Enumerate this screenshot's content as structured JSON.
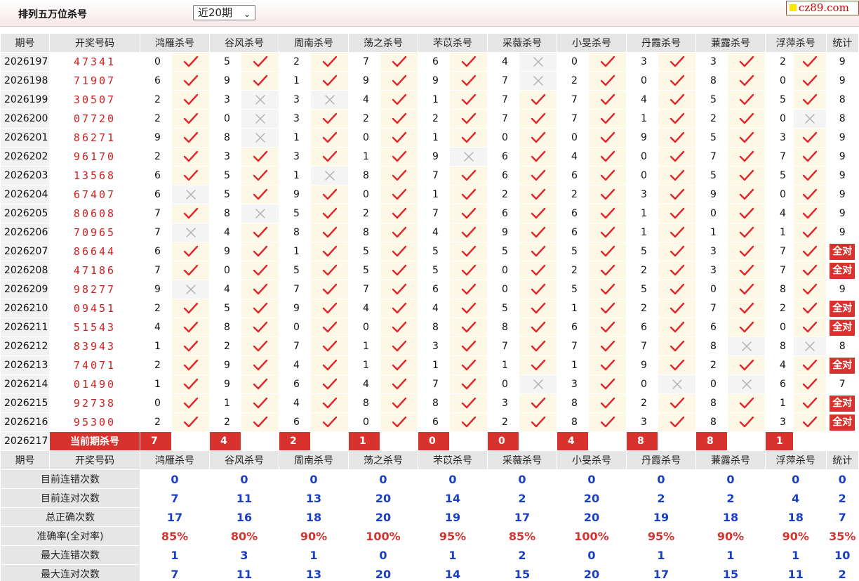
{
  "page": {
    "title": "排列五万位杀号",
    "period_select": "近20期",
    "brand": "cz89.com"
  },
  "columns": {
    "issue": "期号",
    "draw": "开奖号码",
    "experts": [
      "鸿雁杀号",
      "谷风杀号",
      "周南杀号",
      "荡之杀号",
      "芣苡杀号",
      "采薇杀号",
      "小旻杀号",
      "丹霞杀号",
      "蒹露杀号",
      "浮萍杀号"
    ],
    "stat": "统计"
  },
  "rows": [
    {
      "issue": "2026197",
      "draw": "47341",
      "picks": [
        "0",
        "5",
        "2",
        "7",
        "6",
        "4",
        "0",
        "3",
        "3",
        "2"
      ],
      "ok": [
        1,
        1,
        1,
        1,
        1,
        0,
        1,
        1,
        1,
        1
      ],
      "stat": "9"
    },
    {
      "issue": "2026198",
      "draw": "71907",
      "picks": [
        "6",
        "9",
        "1",
        "9",
        "9",
        "7",
        "2",
        "0",
        "8",
        "0"
      ],
      "ok": [
        1,
        1,
        1,
        1,
        1,
        0,
        1,
        1,
        1,
        1
      ],
      "stat": "9"
    },
    {
      "issue": "2026199",
      "draw": "30507",
      "picks": [
        "2",
        "3",
        "3",
        "4",
        "1",
        "7",
        "7",
        "4",
        "5",
        "5"
      ],
      "ok": [
        1,
        0,
        0,
        1,
        1,
        1,
        1,
        1,
        1,
        1
      ],
      "stat": "8"
    },
    {
      "issue": "2026200",
      "draw": "07720",
      "picks": [
        "2",
        "0",
        "3",
        "2",
        "2",
        "7",
        "7",
        "1",
        "2",
        "0"
      ],
      "ok": [
        1,
        0,
        1,
        1,
        1,
        1,
        1,
        1,
        1,
        0
      ],
      "stat": "8"
    },
    {
      "issue": "2026201",
      "draw": "86271",
      "picks": [
        "9",
        "8",
        "1",
        "0",
        "1",
        "0",
        "0",
        "9",
        "5",
        "3"
      ],
      "ok": [
        1,
        0,
        1,
        1,
        1,
        1,
        1,
        1,
        1,
        1
      ],
      "stat": "9"
    },
    {
      "issue": "2026202",
      "draw": "96170",
      "picks": [
        "2",
        "3",
        "3",
        "1",
        "9",
        "6",
        "4",
        "0",
        "7",
        "7"
      ],
      "ok": [
        1,
        1,
        1,
        1,
        0,
        1,
        1,
        1,
        1,
        1
      ],
      "stat": "9"
    },
    {
      "issue": "2026203",
      "draw": "13568",
      "picks": [
        "6",
        "5",
        "1",
        "8",
        "7",
        "6",
        "6",
        "0",
        "5",
        "5"
      ],
      "ok": [
        1,
        1,
        0,
        1,
        1,
        1,
        1,
        1,
        1,
        1
      ],
      "stat": "9"
    },
    {
      "issue": "2026204",
      "draw": "67407",
      "picks": [
        "6",
        "5",
        "9",
        "0",
        "1",
        "2",
        "2",
        "3",
        "9",
        "0"
      ],
      "ok": [
        0,
        1,
        1,
        1,
        1,
        1,
        1,
        1,
        1,
        1
      ],
      "stat": "9"
    },
    {
      "issue": "2026205",
      "draw": "80608",
      "picks": [
        "7",
        "8",
        "5",
        "2",
        "7",
        "6",
        "6",
        "1",
        "0",
        "4"
      ],
      "ok": [
        1,
        0,
        1,
        1,
        1,
        1,
        1,
        1,
        1,
        1
      ],
      "stat": "9"
    },
    {
      "issue": "2026206",
      "draw": "70965",
      "picks": [
        "7",
        "4",
        "8",
        "8",
        "4",
        "9",
        "6",
        "1",
        "1",
        "1"
      ],
      "ok": [
        0,
        1,
        1,
        1,
        1,
        1,
        1,
        1,
        1,
        1
      ],
      "stat": "9"
    },
    {
      "issue": "2026207",
      "draw": "86644",
      "picks": [
        "6",
        "9",
        "1",
        "5",
        "5",
        "5",
        "5",
        "5",
        "3",
        "7"
      ],
      "ok": [
        1,
        1,
        1,
        1,
        1,
        1,
        1,
        1,
        1,
        1
      ],
      "stat": "全对"
    },
    {
      "issue": "2026208",
      "draw": "47186",
      "picks": [
        "7",
        "0",
        "5",
        "5",
        "5",
        "0",
        "2",
        "2",
        "3",
        "7"
      ],
      "ok": [
        1,
        1,
        1,
        1,
        1,
        1,
        1,
        1,
        1,
        1
      ],
      "stat": "全对"
    },
    {
      "issue": "2026209",
      "draw": "98277",
      "picks": [
        "9",
        "4",
        "7",
        "7",
        "6",
        "0",
        "5",
        "5",
        "0",
        "8"
      ],
      "ok": [
        0,
        1,
        1,
        1,
        1,
        1,
        1,
        1,
        1,
        1
      ],
      "stat": "9"
    },
    {
      "issue": "2026210",
      "draw": "09451",
      "picks": [
        "2",
        "5",
        "9",
        "4",
        "4",
        "5",
        "1",
        "2",
        "7",
        "2"
      ],
      "ok": [
        1,
        1,
        1,
        1,
        1,
        1,
        1,
        1,
        1,
        1
      ],
      "stat": "全对"
    },
    {
      "issue": "2026211",
      "draw": "51543",
      "picks": [
        "4",
        "8",
        "0",
        "0",
        "8",
        "8",
        "6",
        "6",
        "6",
        "0"
      ],
      "ok": [
        1,
        1,
        1,
        1,
        1,
        1,
        1,
        1,
        1,
        1
      ],
      "stat": "全对"
    },
    {
      "issue": "2026212",
      "draw": "83943",
      "picks": [
        "1",
        "2",
        "7",
        "1",
        "3",
        "7",
        "7",
        "7",
        "8",
        "8"
      ],
      "ok": [
        1,
        1,
        1,
        1,
        1,
        1,
        1,
        1,
        0,
        0
      ],
      "stat": "8"
    },
    {
      "issue": "2026213",
      "draw": "74071",
      "picks": [
        "2",
        "9",
        "4",
        "1",
        "1",
        "1",
        "1",
        "9",
        "2",
        "4"
      ],
      "ok": [
        1,
        1,
        1,
        1,
        1,
        1,
        1,
        1,
        1,
        1
      ],
      "stat": "全对"
    },
    {
      "issue": "2026214",
      "draw": "01490",
      "picks": [
        "1",
        "9",
        "6",
        "4",
        "7",
        "0",
        "3",
        "0",
        "0",
        "6"
      ],
      "ok": [
        1,
        1,
        1,
        1,
        1,
        0,
        1,
        0,
        0,
        1
      ],
      "stat": "7"
    },
    {
      "issue": "2026215",
      "draw": "92738",
      "picks": [
        "0",
        "1",
        "4",
        "8",
        "8",
        "3",
        "8",
        "2",
        "8",
        "1"
      ],
      "ok": [
        1,
        1,
        1,
        1,
        1,
        1,
        1,
        1,
        1,
        1
      ],
      "stat": "全对"
    },
    {
      "issue": "2026216",
      "draw": "95300",
      "picks": [
        "2",
        "2",
        "6",
        "0",
        "6",
        "2",
        "8",
        "3",
        "8",
        "3"
      ],
      "ok": [
        1,
        1,
        1,
        1,
        1,
        1,
        1,
        1,
        1,
        1
      ],
      "stat": "全对"
    }
  ],
  "current": {
    "issue": "2026217",
    "label": "当前期杀号",
    "picks": [
      "7",
      "4",
      "2",
      "1",
      "0",
      "0",
      "4",
      "8",
      "8",
      "1"
    ]
  },
  "stats": [
    {
      "label": "目前连错次数",
      "values": [
        "0",
        "0",
        "0",
        "0",
        "0",
        "0",
        "0",
        "0",
        "0",
        "0"
      ],
      "total": "0",
      "red": false
    },
    {
      "label": "目前连对次数",
      "values": [
        "7",
        "11",
        "13",
        "20",
        "14",
        "2",
        "20",
        "2",
        "2",
        "4"
      ],
      "total": "2",
      "red": false
    },
    {
      "label": "总正确次数",
      "values": [
        "17",
        "16",
        "18",
        "20",
        "19",
        "17",
        "20",
        "19",
        "18",
        "18"
      ],
      "total": "7",
      "red": false
    },
    {
      "label": "准确率(全对率)",
      "values": [
        "85%",
        "80%",
        "90%",
        "100%",
        "95%",
        "85%",
        "100%",
        "95%",
        "90%",
        "90%"
      ],
      "total": "35%",
      "red": true
    },
    {
      "label": "最大连错次数",
      "values": [
        "1",
        "3",
        "1",
        "0",
        "1",
        "2",
        "0",
        "1",
        "1",
        "1"
      ],
      "total": "10",
      "red": false
    },
    {
      "label": "最大连对次数",
      "values": [
        "7",
        "11",
        "13",
        "20",
        "14",
        "15",
        "20",
        "17",
        "15",
        "11"
      ],
      "total": "2",
      "red": false
    }
  ],
  "icons": {
    "correct": "check-icon",
    "wrong": "cross-icon"
  },
  "colors": {
    "accent_red": "#d8322f",
    "stat_blue": "#1a3fc4",
    "correct_bg": "#fdf8e6",
    "check": "#e0262b",
    "cross": "#b0b0b0"
  }
}
